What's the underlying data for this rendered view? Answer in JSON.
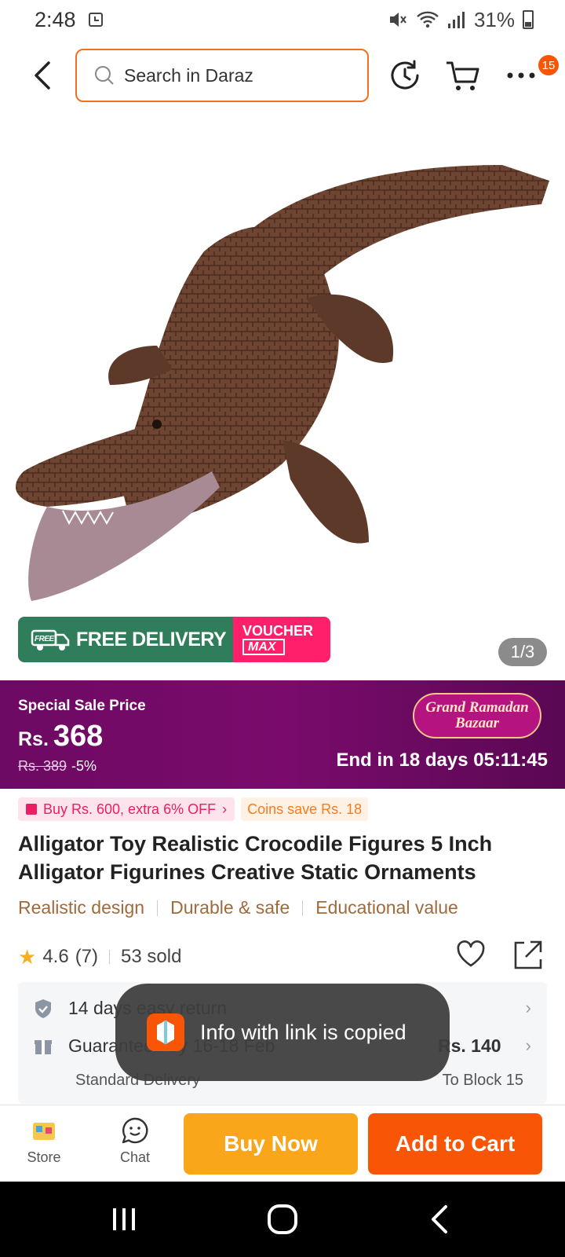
{
  "status_bar": {
    "time": "2:48",
    "battery": "31%"
  },
  "top_bar": {
    "search_placeholder": "Search in Daraz",
    "more_badge": "15"
  },
  "gallery": {
    "promo_free": "FREE DELIVERY",
    "promo_voucher": "VOUCHER",
    "promo_max": "MAX",
    "page_indicator": "1/3",
    "free_tag": "FREE"
  },
  "sale": {
    "label": "Special Sale Price",
    "currency": "Rs.",
    "price": "368",
    "old_price": "Rs. 389",
    "discount": "-5%",
    "campaign_line1": "Grand Ramadan",
    "campaign_line2": "Bazaar",
    "countdown": "End in 18 days 05:11:45"
  },
  "tags": {
    "coupon": "Buy Rs. 600, extra 6% OFF",
    "coins": "Coins save Rs. 18"
  },
  "product": {
    "title": "Alligator Toy Realistic Crocodile Figures 5 Inch Alligator Figurines Creative Static Ornaments",
    "highlights": [
      "Realistic design",
      "Durable & safe",
      "Educational value"
    ],
    "rating": "4.6",
    "rating_count": "(7)",
    "sold": "53 sold"
  },
  "info": {
    "return_text": "14 days easy return",
    "delivery_text": "Guaranteed by 16-18 Feb",
    "delivery_price": "Rs. 140",
    "delivery_type": "Standard Delivery",
    "delivery_to": "To Block 15"
  },
  "toast": {
    "message": "Info with link is copied"
  },
  "bottom_bar": {
    "store": "Store",
    "chat": "Chat",
    "buy_now": "Buy Now",
    "add_to_cart": "Add to Cart"
  },
  "colors": {
    "brand_orange": "#f85606",
    "buy_now_yellow": "#faa61a",
    "sale_purple": "#6d0a63",
    "promo_green": "#2f7d5b",
    "promo_pink": "#ff1f6a"
  }
}
